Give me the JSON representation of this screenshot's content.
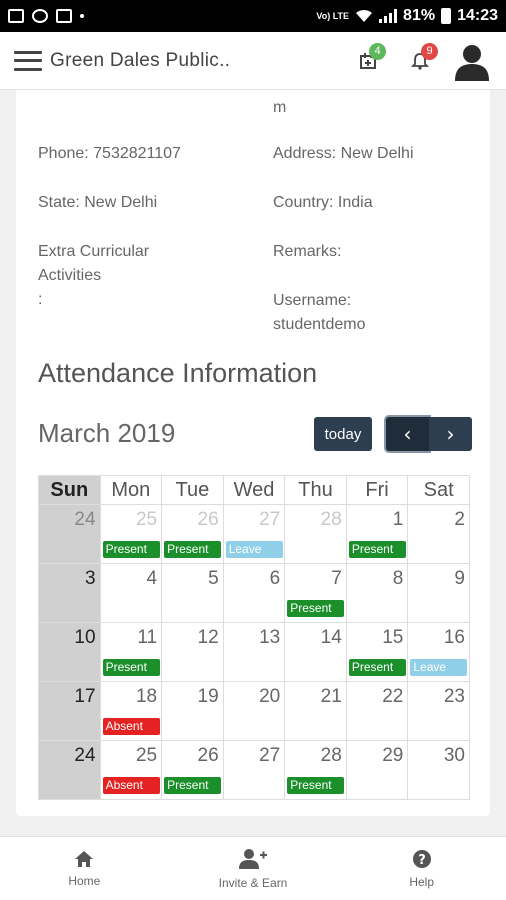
{
  "status_bar": {
    "battery": "81%",
    "time": "14:23",
    "network": "Vo) LTE"
  },
  "header": {
    "title": "Green Dales Public..",
    "calendar_badge": "4",
    "notification_badge": "9"
  },
  "profile": {
    "email_tail": "m",
    "phone": "Phone: 7532821107",
    "address": "Address: New Delhi",
    "state": "State: New Delhi",
    "country": "Country: India",
    "extra_line1": "Extra Curricular",
    "extra_line2": "Activities",
    "extra_line3": ":",
    "remarks": "Remarks:",
    "username_label": "Username:",
    "username_value": "studentdemo"
  },
  "attendance": {
    "section_title": "Attendance Information",
    "month": "March 2019",
    "today_label": "today",
    "prev_label": "‹",
    "next_label": "›",
    "weekdays": [
      "Sun",
      "Mon",
      "Tue",
      "Wed",
      "Thu",
      "Fri",
      "Sat"
    ],
    "weeks": [
      [
        {
          "day": "24",
          "other": true
        },
        {
          "day": "25",
          "other": true,
          "status": "Present"
        },
        {
          "day": "26",
          "other": true,
          "status": "Present"
        },
        {
          "day": "27",
          "other": true,
          "status": "Leave"
        },
        {
          "day": "28",
          "other": true
        },
        {
          "day": "1",
          "status": "Present"
        },
        {
          "day": "2"
        }
      ],
      [
        {
          "day": "3"
        },
        {
          "day": "4"
        },
        {
          "day": "5"
        },
        {
          "day": "6"
        },
        {
          "day": "7",
          "status": "Present"
        },
        {
          "day": "8"
        },
        {
          "day": "9"
        }
      ],
      [
        {
          "day": "10"
        },
        {
          "day": "11",
          "status": "Present"
        },
        {
          "day": "12"
        },
        {
          "day": "13"
        },
        {
          "day": "14"
        },
        {
          "day": "15",
          "status": "Present"
        },
        {
          "day": "16",
          "status": "Leave"
        }
      ],
      [
        {
          "day": "17"
        },
        {
          "day": "18",
          "status": "Absent"
        },
        {
          "day": "19"
        },
        {
          "day": "20"
        },
        {
          "day": "21"
        },
        {
          "day": "22"
        },
        {
          "day": "23"
        }
      ],
      [
        {
          "day": "24"
        },
        {
          "day": "25",
          "status": "Absent"
        },
        {
          "day": "26",
          "status": "Present"
        },
        {
          "day": "27"
        },
        {
          "day": "28",
          "status": "Present"
        },
        {
          "day": "29"
        },
        {
          "day": "30"
        }
      ]
    ]
  },
  "bottom_nav": [
    {
      "label": "Home",
      "icon": "home-icon"
    },
    {
      "label": "Invite & Earn",
      "icon": "add-user-icon"
    },
    {
      "label": "Help",
      "icon": "help-icon"
    }
  ]
}
